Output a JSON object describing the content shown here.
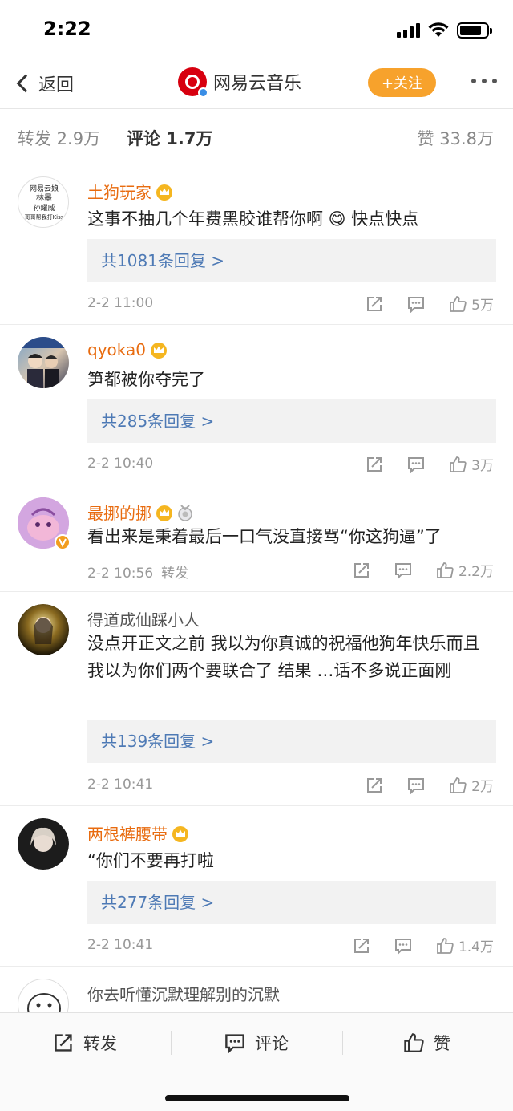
{
  "status": {
    "time": "2:22"
  },
  "nav": {
    "back_label": "返回",
    "title": "网易云音乐",
    "follow_label": "+关注"
  },
  "tabs": {
    "repost": "转发 2.9万",
    "comment": "评论 1.7万",
    "like": "赞 33.8万"
  },
  "comments": [
    {
      "user": "土狗玩家",
      "text": "这事不抽几个年费黑胶谁帮你啊 😋 快点快点",
      "replies": "共1081条回复 >",
      "time": "2-2 11:00",
      "likes": "5万"
    },
    {
      "user": "qyoka0",
      "text": "笋都被你夺完了",
      "replies": "共285条回复 >",
      "time": "2-2 10:40",
      "likes": "3万"
    },
    {
      "user": "最挪的挪",
      "text": "看出来是秉着最后一口气没直接骂“你这狗逼”了",
      "time": "2-2 10:56",
      "repost_label": "转发",
      "likes": "2.2万"
    },
    {
      "user": "得道成仙踩小人",
      "text": "没点开正文之前 我以为你真诚的祝福他狗年快乐而且我以为你们两个要联合了 结果 …话不多说正面刚",
      "replies": "共139条回复 >",
      "time": "2-2 10:41",
      "likes": "2万"
    },
    {
      "user": "两根裤腰带",
      "text": "“你们不要再打啦",
      "replies": "共277条回复 >",
      "time": "2-2 10:41",
      "likes": "1.4万"
    },
    {
      "user": "你去听懂沉默理解别的沉默"
    }
  ],
  "avatar_text": {
    "line1": "网易云娘",
    "line2": "林墨",
    "line3": "孙耀威",
    "line4": "哥哥帮我打Kiss"
  },
  "bottom_bar": {
    "repost": "转发",
    "comment": "评论",
    "like": "赞"
  },
  "colors": {
    "accent_orange": "#f7a22c",
    "username_orange": "#e86b0f",
    "reply_link": "#4e7ab5",
    "netease_red": "#d7000f"
  }
}
